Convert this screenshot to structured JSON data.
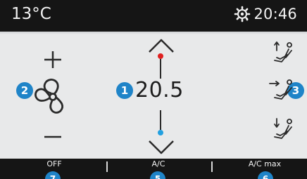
{
  "status_bar": {
    "outside_temperature": "13°C",
    "clock": "20:46",
    "icon": "gear-sun-icon"
  },
  "controls": {
    "fan": {
      "increase_icon": "plus-icon",
      "decrease_icon": "minus-icon",
      "fan_icon": "fan-icon",
      "badge": "2"
    },
    "temperature": {
      "setpoint": "20.5",
      "badge": "1",
      "up_icon": "chevron-up-icon",
      "down_icon": "chevron-down-icon",
      "hot_color": "#e02020",
      "cold_color": "#22a0e0"
    },
    "airflow": {
      "badge": "3",
      "modes": [
        "airflow-up-icon",
        "airflow-middle-icon",
        "airflow-down-icon"
      ]
    }
  },
  "bottom_bar": {
    "buttons": [
      {
        "label": "OFF",
        "badge": "7"
      },
      {
        "label": "A/C",
        "badge": "5"
      },
      {
        "label": "A/C max",
        "badge": "6"
      }
    ]
  },
  "colors": {
    "accent": "#1f84c8",
    "bar_background": "#151515",
    "panel_background": "#e8e9ea"
  }
}
